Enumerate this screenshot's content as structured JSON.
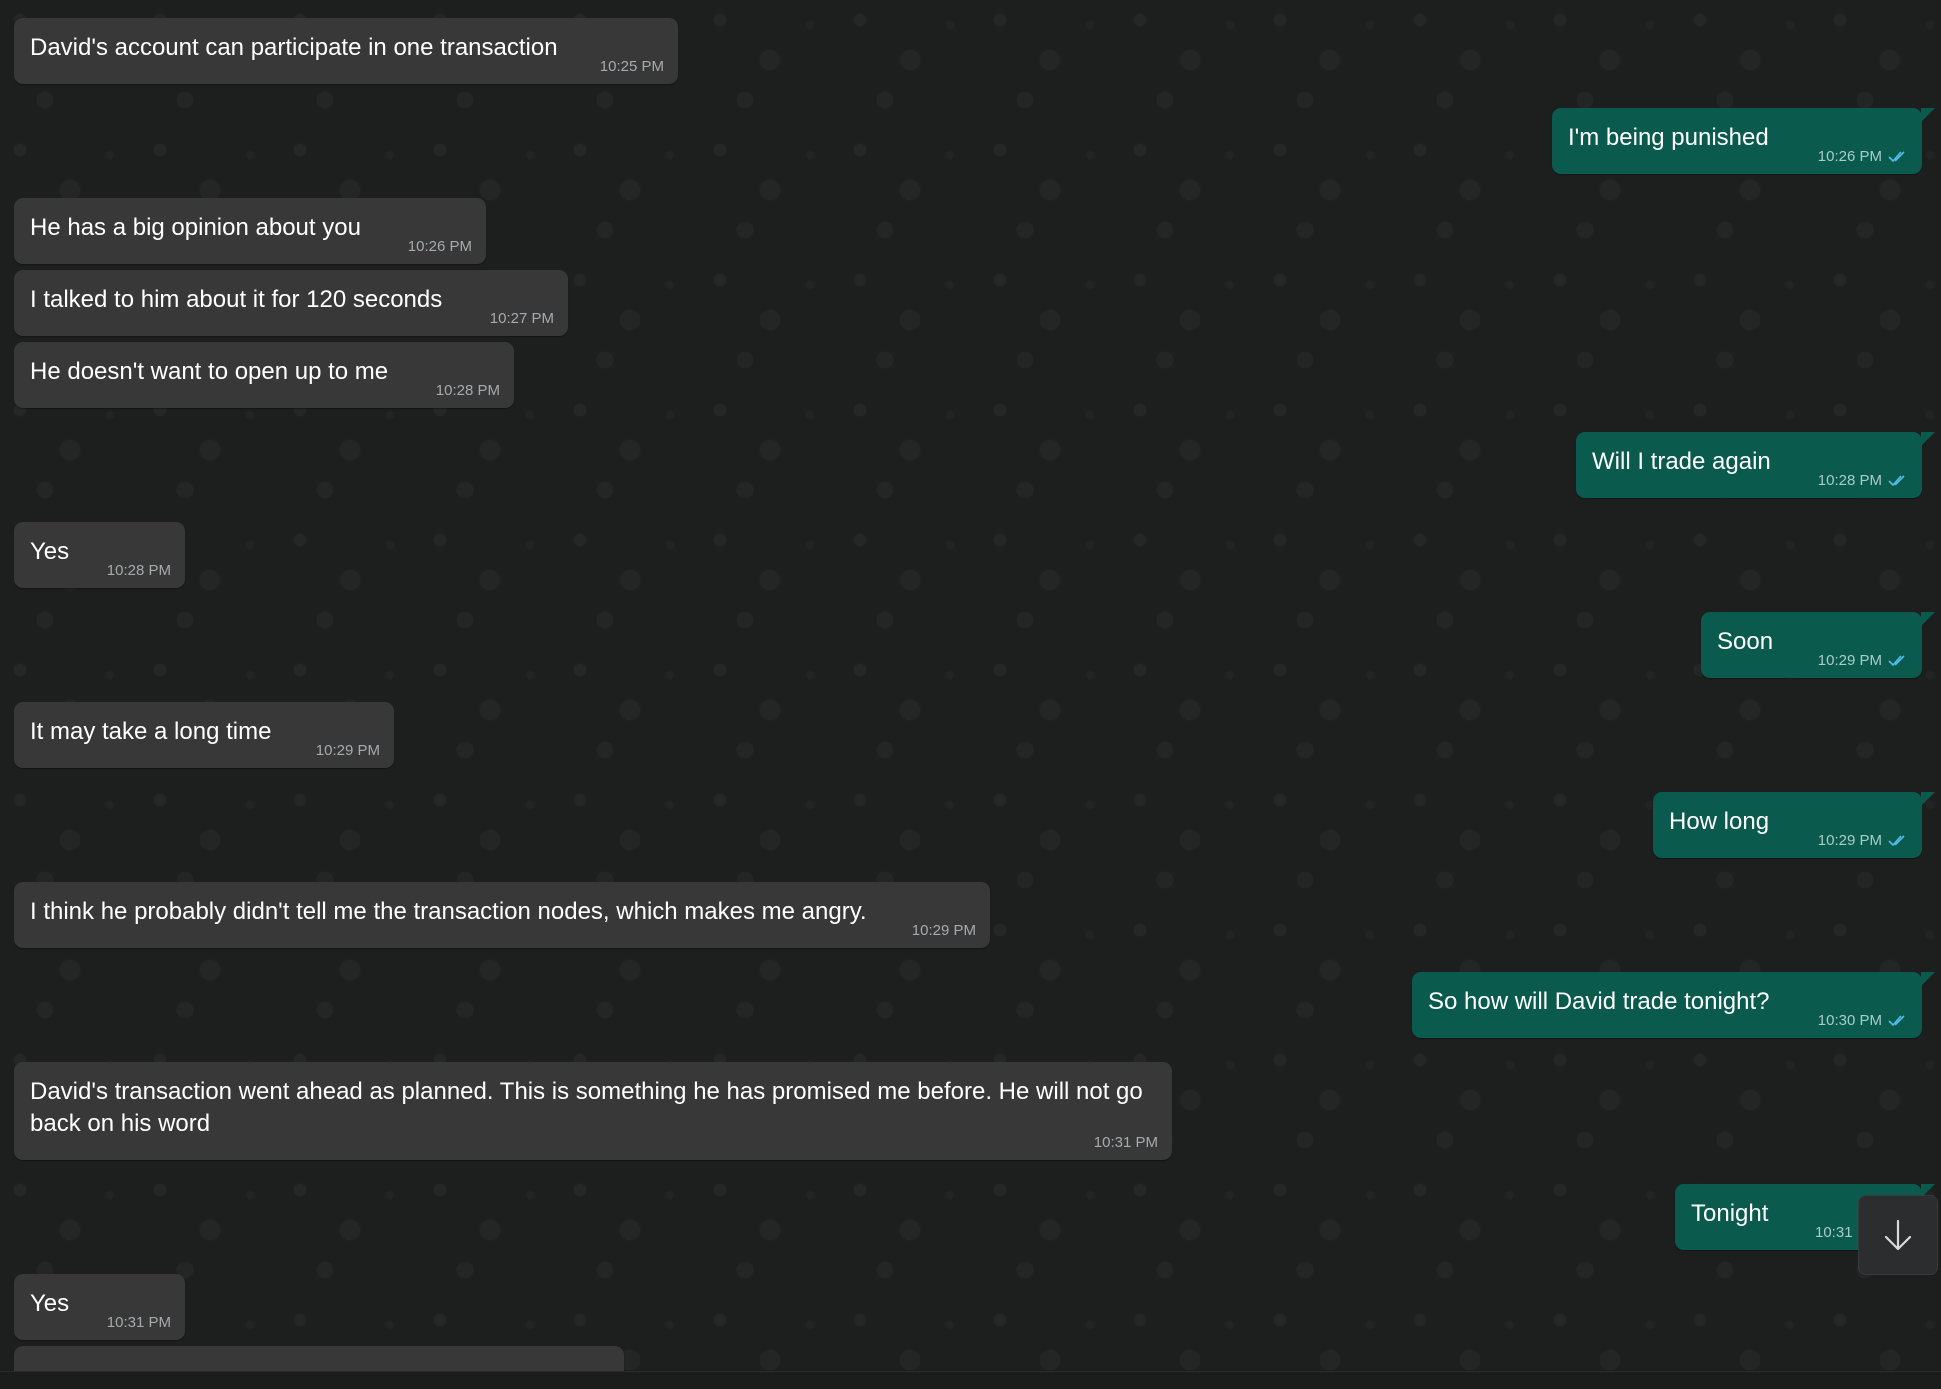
{
  "conversation": {
    "messages": [
      {
        "direction": "in",
        "text": "David's account can participate in one transaction",
        "time": "10:25 PM"
      },
      {
        "direction": "out",
        "text": "I'm being punished",
        "time": "10:26 PM"
      },
      {
        "direction": "in",
        "text": "He has a big opinion about you",
        "time": "10:26 PM"
      },
      {
        "direction": "in",
        "text": "I talked to him about it for 120 seconds",
        "time": "10:27 PM"
      },
      {
        "direction": "in",
        "text": "He doesn't want to open up to me",
        "time": "10:28 PM"
      },
      {
        "direction": "out",
        "text": "Will I trade again",
        "time": "10:28 PM"
      },
      {
        "direction": "in",
        "text": "Yes",
        "time": "10:28 PM"
      },
      {
        "direction": "out",
        "text": "Soon",
        "time": "10:29 PM"
      },
      {
        "direction": "in",
        "text": "It may take a long time",
        "time": "10:29 PM"
      },
      {
        "direction": "out",
        "text": "How long",
        "time": "10:29 PM"
      },
      {
        "direction": "in",
        "text": "I think he probably didn't tell me the transaction nodes, which makes me angry.",
        "time": "10:29 PM"
      },
      {
        "direction": "out",
        "text": "So how will David trade tonight?",
        "time": "10:30 PM"
      },
      {
        "direction": "in",
        "text": "David's transaction went ahead as planned. This is something he has promised me before. He will not go back on his word",
        "time": "10:31 PM"
      },
      {
        "direction": "out",
        "text": "Tonight",
        "time": "10:31"
      },
      {
        "direction": "in",
        "text": "Yes",
        "time": "10:31 PM"
      },
      {
        "direction": "in",
        "text": "",
        "time": ""
      }
    ]
  },
  "status": {
    "read_icon": "double-check-icon",
    "read_color": "#53bdeb"
  },
  "scroll_button": {
    "icon": "arrow-down-icon"
  }
}
